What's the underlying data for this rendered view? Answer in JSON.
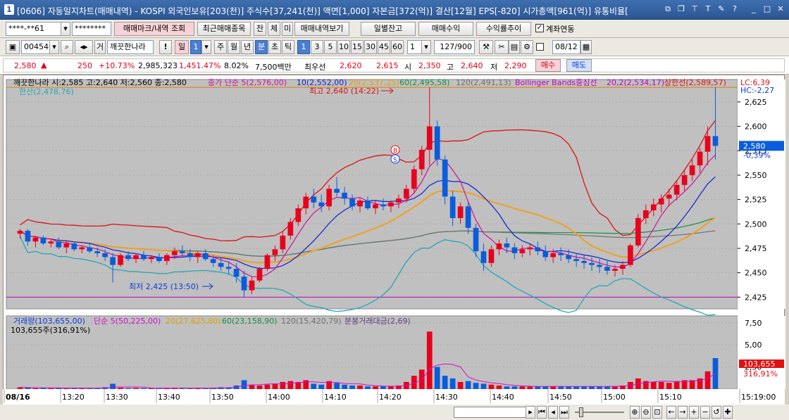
{
  "window": {
    "num": "1",
    "title": "[0606] 자동일지차트(매매내역) - KOSPI 외국인보유[203(천)] 주식수[37,241(천)] 액면[1,000] 자본금[372(억)] 결산[12월] EPS[-820] 시가총액[961(억)] 유통비율["
  },
  "toolbar1": {
    "account": "****-**61",
    "password": "********",
    "btn_mark": "매매마크/내역 조회",
    "btn_recent": "최근매매종목",
    "btn_jan": "잔",
    "btn_che": "체",
    "btn_mi": "미",
    "btn_view": "매매내역보기",
    "btn_daily": "일별잔고",
    "btn_profit": "매매수익",
    "btn_yield": "수익률추이",
    "chk_link": "계좌연동"
  },
  "toolbar2": {
    "code": "004540",
    "btn_ga": "거",
    "name": "깨끗한나라",
    "btn_il": "일",
    "il_val": "1",
    "btn_ju": "주",
    "btn_wol": "월",
    "btn_nyeon": "년",
    "btn_bun": "분",
    "btn_cho": "초",
    "btn_tik": "틱",
    "periods": [
      "1",
      "3",
      "5",
      "10",
      "15",
      "30",
      "45",
      "60"
    ],
    "period_sel": "1",
    "count": "127/900",
    "date": "08/12"
  },
  "quote": {
    "price": "2,580",
    "chg": "250",
    "rate": "+10.73%",
    "vol": "2,985,323",
    "vol_rate": "1,451.47%",
    "turn": "8.02%",
    "amt": "7,500백만",
    "best_label": "최우선",
    "best_ask": "2,620",
    "best_bid": "2,615",
    "open_label": "시",
    "open": "2,350",
    "high_label": "고",
    "high": "2,640",
    "low_label": "저",
    "low": "2,290",
    "buy": "매수",
    "sell": "매도"
  },
  "price_panel": {
    "legend_name": "깨끗한나라 시:2,585 고:2,640 저:2,560 종:2,580",
    "ma_close": "종가 단순 5(2,576,00)",
    "ma10": "10(2,552,00)",
    "ma20": "20(2,537,25)",
    "ma60": "60(2,495,58)",
    "ma120": "120(2,491,13)",
    "bb": "Bollinger Bands중심선",
    "bb_val": "20,2(2,534,17)",
    "upper_limit": "상한선(2,589,57)",
    "prev_line": "한산(2,478,76)",
    "lc": "LC:6,39",
    "hc": "HC:-2,27",
    "high_mark": "최고 2,640 (14:22)",
    "low_mark": "최저 2,425 (13:50)",
    "cur_price": "2,580",
    "cur_rate": "-0,39%",
    "badge_b": "B",
    "badge_s": "S"
  },
  "vol_panel": {
    "legend_vol": "거래량(103,655,00)",
    "legend_ma5": "단순 5(50,225,00)",
    "legend_ma20": "20(27,625,80)",
    "legend_ma60": "60(23,158,90)",
    "legend_ma120": "120(15,420,79)",
    "legend_amt": "분봉거래대금(2,69)",
    "sub": "103,655주(316,91%)",
    "cur": "103,655",
    "cur_rate": "316,91%"
  },
  "chart_data": {
    "type": "candlestick",
    "price_ticks": [
      "2,625",
      "2,600",
      "2,575",
      "2,550",
      "2,525",
      "2,500",
      "2,475",
      "2,450",
      "2,425"
    ],
    "vol_ticks": [
      "7,50",
      "5,00",
      "2,50"
    ],
    "x_ticks": [
      "08/16",
      "13:20",
      "13:30",
      "13:40",
      "13:50",
      "14:00",
      "14:10",
      "14:20",
      "14:30",
      "14:40",
      "14:50",
      "15:00",
      "15:10",
      "15:19:00"
    ],
    "candles": [
      [
        2490,
        2495,
        2485,
        2493
      ],
      [
        2493,
        2495,
        2478,
        2482
      ],
      [
        2482,
        2488,
        2476,
        2486
      ],
      [
        2486,
        2488,
        2478,
        2480
      ],
      [
        2480,
        2484,
        2476,
        2482
      ],
      [
        2482,
        2486,
        2474,
        2476
      ],
      [
        2476,
        2482,
        2470,
        2480
      ],
      [
        2480,
        2482,
        2472,
        2474
      ],
      [
        2474,
        2478,
        2470,
        2476
      ],
      [
        2476,
        2480,
        2470,
        2472
      ],
      [
        2472,
        2476,
        2466,
        2470
      ],
      [
        2470,
        2474,
        2462,
        2466
      ],
      [
        2466,
        2470,
        2440,
        2458
      ],
      [
        2458,
        2470,
        2456,
        2468
      ],
      [
        2468,
        2472,
        2462,
        2464
      ],
      [
        2464,
        2470,
        2460,
        2468
      ],
      [
        2468,
        2472,
        2462,
        2464
      ],
      [
        2464,
        2468,
        2460,
        2466
      ],
      [
        2466,
        2470,
        2460,
        2462
      ],
      [
        2462,
        2470,
        2458,
        2468
      ],
      [
        2468,
        2476,
        2464,
        2472
      ],
      [
        2472,
        2478,
        2466,
        2470
      ],
      [
        2470,
        2474,
        2462,
        2466
      ],
      [
        2466,
        2472,
        2460,
        2470
      ],
      [
        2470,
        2474,
        2462,
        2464
      ],
      [
        2464,
        2468,
        2456,
        2460
      ],
      [
        2460,
        2466,
        2452,
        2456
      ],
      [
        2456,
        2462,
        2448,
        2454
      ],
      [
        2454,
        2460,
        2440,
        2446
      ],
      [
        2446,
        2452,
        2425,
        2432
      ],
      [
        2432,
        2446,
        2428,
        2442
      ],
      [
        2442,
        2456,
        2440,
        2454
      ],
      [
        2454,
        2470,
        2452,
        2468
      ],
      [
        2468,
        2478,
        2462,
        2474
      ],
      [
        2474,
        2492,
        2470,
        2488
      ],
      [
        2488,
        2506,
        2484,
        2502
      ],
      [
        2502,
        2520,
        2498,
        2516
      ],
      [
        2516,
        2532,
        2510,
        2528
      ],
      [
        2528,
        2536,
        2516,
        2522
      ],
      [
        2522,
        2530,
        2512,
        2518
      ],
      [
        2518,
        2540,
        2514,
        2536
      ],
      [
        2536,
        2548,
        2528,
        2532
      ],
      [
        2532,
        2538,
        2520,
        2526
      ],
      [
        2526,
        2530,
        2514,
        2518
      ],
      [
        2518,
        2526,
        2512,
        2524
      ],
      [
        2524,
        2528,
        2514,
        2516
      ],
      [
        2516,
        2524,
        2510,
        2520
      ],
      [
        2520,
        2526,
        2514,
        2518
      ],
      [
        2518,
        2524,
        2512,
        2522
      ],
      [
        2522,
        2530,
        2516,
        2526
      ],
      [
        2526,
        2540,
        2522,
        2536
      ],
      [
        2536,
        2560,
        2532,
        2556
      ],
      [
        2556,
        2580,
        2550,
        2576
      ],
      [
        2576,
        2640,
        2560,
        2600
      ],
      [
        2600,
        2606,
        2560,
        2566
      ],
      [
        2566,
        2570,
        2520,
        2528
      ],
      [
        2528,
        2534,
        2498,
        2506
      ],
      [
        2506,
        2522,
        2500,
        2518
      ],
      [
        2518,
        2522,
        2490,
        2496
      ],
      [
        2496,
        2500,
        2466,
        2472
      ],
      [
        2472,
        2480,
        2452,
        2460
      ],
      [
        2460,
        2478,
        2456,
        2474
      ],
      [
        2474,
        2484,
        2468,
        2480
      ],
      [
        2480,
        2486,
        2470,
        2476
      ],
      [
        2476,
        2480,
        2464,
        2470
      ],
      [
        2470,
        2478,
        2466,
        2474
      ],
      [
        2474,
        2480,
        2468,
        2476
      ],
      [
        2476,
        2482,
        2468,
        2472
      ],
      [
        2472,
        2478,
        2462,
        2466
      ],
      [
        2466,
        2474,
        2460,
        2470
      ],
      [
        2470,
        2476,
        2462,
        2468
      ],
      [
        2468,
        2474,
        2460,
        2464
      ],
      [
        2464,
        2470,
        2456,
        2462
      ],
      [
        2462,
        2468,
        2454,
        2460
      ],
      [
        2460,
        2466,
        2452,
        2458
      ],
      [
        2458,
        2464,
        2450,
        2456
      ],
      [
        2456,
        2462,
        2448,
        2452
      ],
      [
        2452,
        2458,
        2446,
        2454
      ],
      [
        2454,
        2462,
        2448,
        2458
      ],
      [
        2458,
        2480,
        2456,
        2478
      ],
      [
        2478,
        2510,
        2476,
        2506
      ],
      [
        2506,
        2520,
        2500,
        2514
      ],
      [
        2514,
        2526,
        2508,
        2520
      ],
      [
        2520,
        2530,
        2512,
        2526
      ],
      [
        2526,
        2536,
        2518,
        2530
      ],
      [
        2530,
        2544,
        2524,
        2540
      ],
      [
        2540,
        2556,
        2534,
        2550
      ],
      [
        2550,
        2566,
        2544,
        2560
      ],
      [
        2560,
        2578,
        2552,
        2574
      ],
      [
        2574,
        2600,
        2560,
        2590
      ],
      [
        2590,
        2640,
        2566,
        2580
      ]
    ],
    "volumes": [
      0.2,
      0.15,
      0.1,
      0.12,
      0.1,
      0.15,
      0.1,
      0.12,
      0.1,
      0.1,
      0.12,
      0.2,
      0.6,
      0.15,
      0.1,
      0.12,
      0.1,
      0.1,
      0.1,
      0.12,
      0.15,
      0.1,
      0.1,
      0.1,
      0.12,
      0.15,
      0.2,
      0.2,
      0.4,
      1.0,
      0.5,
      0.4,
      0.5,
      0.6,
      0.8,
      0.9,
      0.8,
      1.0,
      0.6,
      0.5,
      0.9,
      0.7,
      0.5,
      0.4,
      0.4,
      0.3,
      0.3,
      0.3,
      0.3,
      0.4,
      0.8,
      1.5,
      2.2,
      6.5,
      2.5,
      1.5,
      1.2,
      0.8,
      0.9,
      0.7,
      0.6,
      0.5,
      0.4,
      0.3,
      0.3,
      0.3,
      0.3,
      0.3,
      0.3,
      0.3,
      0.3,
      0.3,
      0.3,
      0.3,
      0.3,
      0.3,
      0.3,
      0.3,
      0.4,
      0.8,
      1.2,
      0.9,
      0.8,
      0.8,
      0.7,
      0.9,
      1.0,
      1.0,
      1.2,
      2.0,
      3.5
    ]
  }
}
